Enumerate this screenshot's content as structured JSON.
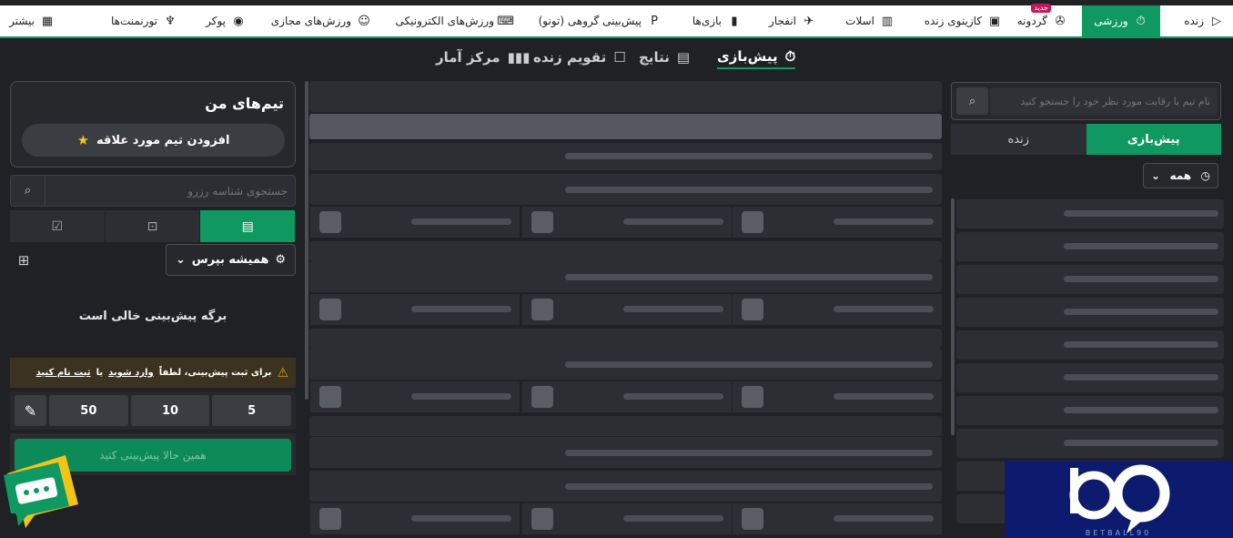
{
  "topnav": {
    "items": [
      {
        "label": "زنده",
        "icon": "live-icon"
      },
      {
        "label": "ورزشی",
        "icon": "stopwatch-icon",
        "active": true
      },
      {
        "label": "گردونه",
        "icon": "wheel-icon",
        "badge": "جدید"
      },
      {
        "label": "کازینوی زنده",
        "icon": "casino-icon"
      },
      {
        "label": "اسلات",
        "icon": "slot-icon"
      },
      {
        "label": "انفجار",
        "icon": "crash-icon"
      },
      {
        "label": "بازی‌ها",
        "icon": "games-icon"
      },
      {
        "label": "پیش‌بینی گروهی (تونو)",
        "icon": "toto-icon"
      },
      {
        "label": "ورزش‌های الکترونیکی",
        "icon": "esports-icon"
      },
      {
        "label": "ورزش‌های مجازی",
        "icon": "virtual-icon"
      },
      {
        "label": "پوکر",
        "icon": "poker-icon"
      },
      {
        "label": "تورنمنت‌ها",
        "icon": "trophy-icon"
      },
      {
        "label": "بیشتر",
        "icon": "grid-icon"
      }
    ]
  },
  "subtabs": [
    {
      "label": "پیش‌بازی",
      "active": true
    },
    {
      "label": "نتایج"
    },
    {
      "label": "تقویم زنده"
    },
    {
      "label": "مرکز آمار"
    }
  ],
  "betslip": {
    "my_teams_title": "تیم‌های من",
    "add_fav_label": "افزودن تیم مورد علاقه",
    "search_placeholder": "جستجوی شناسه رزرو",
    "always_ask": "همیشه بپرس",
    "empty_text": "برگه پیش‌بینی خالی است",
    "warning_prefix": "برای ثبت پیش‌بینی، لطفاً",
    "login_link": "وارد شوید",
    "or_text": "یا",
    "register_link": "ثبت نام کنید",
    "stakes": [
      "5",
      "10",
      "50"
    ],
    "place_label": "همین حالا پیش‌بینی کنید"
  },
  "right_panel": {
    "search_placeholder": "نام تیم یا رقابت مورد نظر خود را جستجو کنید",
    "tab_live": "زنده",
    "tab_prematch": "پیش‌بازی",
    "filter_label": "همه"
  },
  "colors": {
    "accent": "#0f9960",
    "background": "#1f2125",
    "panel": "#2c2e33"
  }
}
